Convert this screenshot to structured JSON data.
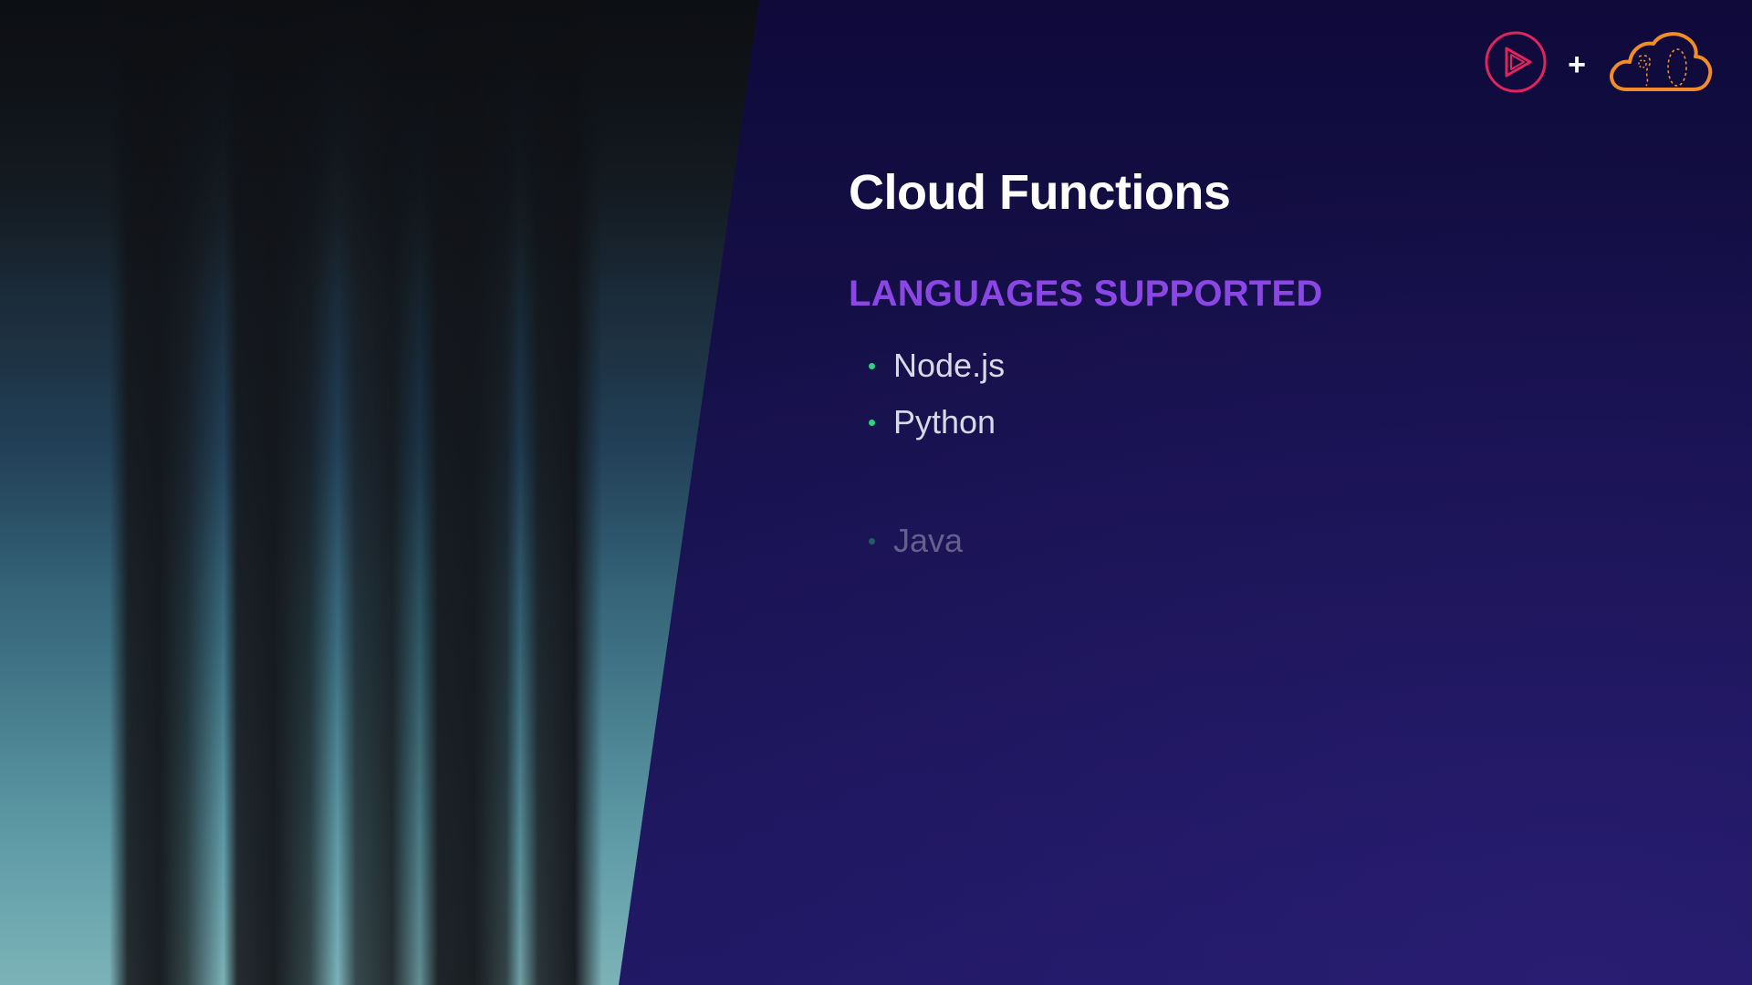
{
  "slide": {
    "title": "Cloud Functions",
    "subtitle": "LANGUAGES SUPPORTED",
    "languages": [
      {
        "label": "Node.js"
      },
      {
        "label": "Python"
      },
      {
        "label": "Java",
        "dimmed": true
      }
    ]
  },
  "header": {
    "plus_sign": "+",
    "logos": [
      {
        "icon": "pluralsight-play-icon",
        "color": "#e0245e"
      },
      {
        "icon": "acloud-guru-cloud-icon",
        "color": "#f28c28"
      }
    ]
  },
  "colors": {
    "background": "#16104a",
    "title": "#ffffff",
    "accent": "#8b47e6",
    "bullet": "#2fd17f",
    "list_text": "#d9d8e6"
  }
}
